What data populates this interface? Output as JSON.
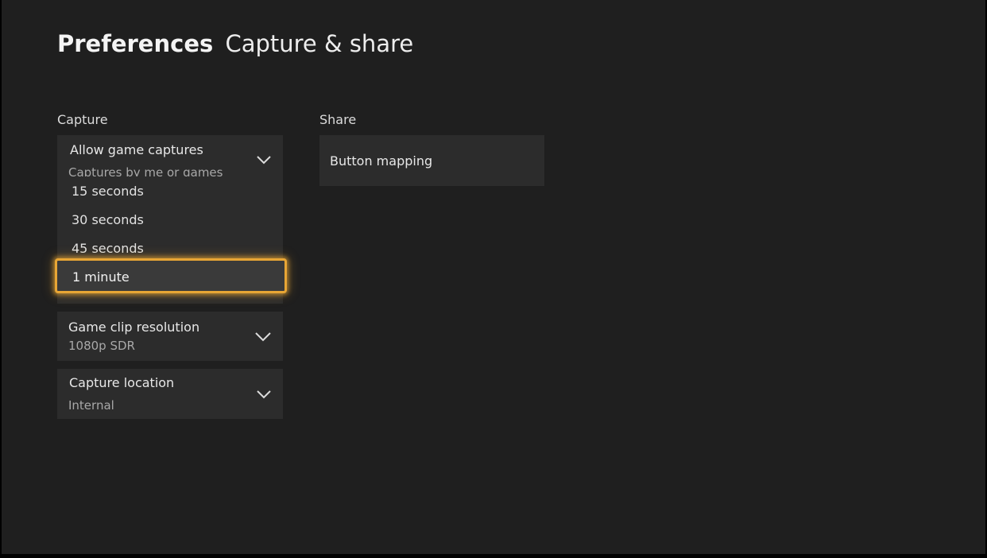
{
  "header": {
    "title": "Preferences",
    "subtitle": "Capture & share"
  },
  "capture": {
    "section_label": "Capture",
    "allow_game_captures": {
      "label": "Allow game captures",
      "value": "Captures by me or games"
    },
    "duration_options": [
      "15 seconds",
      "30 seconds",
      "45 seconds",
      "1 minute"
    ],
    "selected_option": "1 minute",
    "game_clip_resolution": {
      "label": "Game clip resolution",
      "value": "1080p SDR"
    },
    "capture_location": {
      "label": "Capture location",
      "value": "Internal"
    }
  },
  "share": {
    "section_label": "Share",
    "button_mapping": {
      "label": "Button mapping"
    }
  },
  "colors": {
    "background": "#1f1f1f",
    "tile": "#2c2c2c",
    "focus_accent": "#e8a635"
  },
  "icons": {
    "dropdown": "chevron-down-icon"
  }
}
